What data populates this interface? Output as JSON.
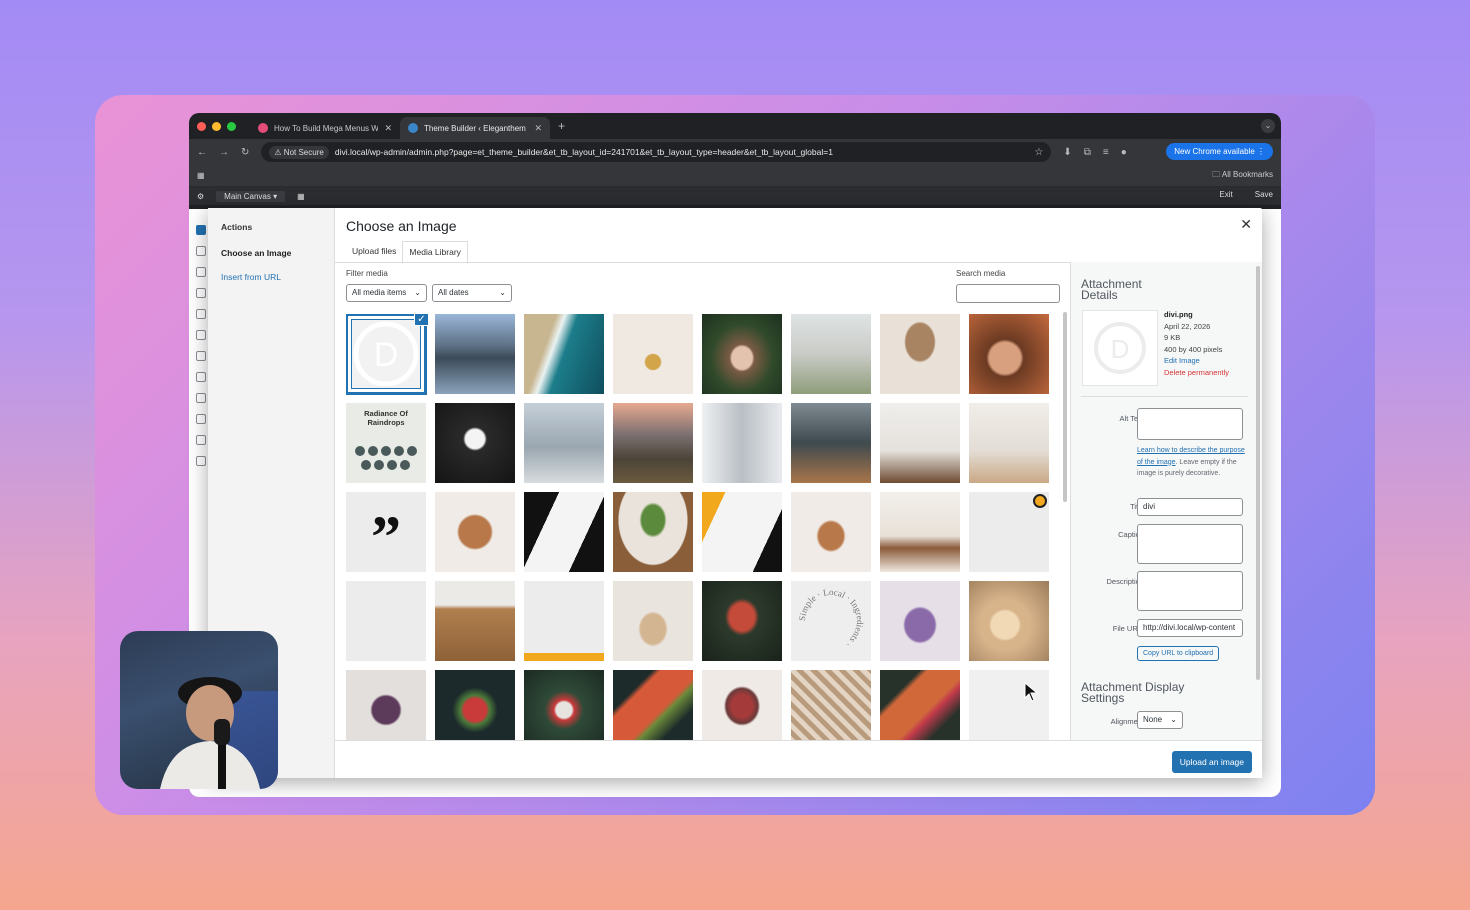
{
  "browser": {
    "tabs": [
      {
        "title": "How To Build Mega Menus W"
      },
      {
        "title": "Theme Builder ‹ Eleganthem"
      }
    ],
    "not_secure": "Not Secure",
    "url": "divi.local/wp-admin/admin.php?page=et_theme_builder&et_tb_layout_id=241701&et_tb_layout_type=header&et_tb_layout_global=1",
    "new_chrome": "New Chrome available",
    "bookmarks": "All Bookmarks"
  },
  "builder": {
    "canvas": "Main Canvas",
    "exit": "Exit",
    "save": "Save"
  },
  "modal": {
    "title": "Choose an Image",
    "sidebar": {
      "heading": "Actions",
      "current": "Choose an Image",
      "insert_url": "Insert from URL"
    },
    "tabs": [
      "Upload files",
      "Media Library"
    ],
    "filter_label": "Filter media",
    "filter_type": "All media items",
    "filter_date": "All dates",
    "search_label": "Search media",
    "thumb_text": {
      "book_title": "Radiance Of Raindrops",
      "quote": "”",
      "circle_text": "Simple · Local · Ingredients ·"
    },
    "upload_button": "Upload an image"
  },
  "details": {
    "heading": "Attachment Details",
    "filename": "divi.png",
    "date": "April 22, 2026",
    "size": "9 KB",
    "dimensions": "400 by 400 pixels",
    "edit": "Edit Image",
    "delete": "Delete permanently",
    "alt_label": "Alt Text",
    "help_link": "Learn how to describe the purpose of the image",
    "help_text": ". Leave empty if the image is purely decorative.",
    "title_label": "Title",
    "title_value": "divi",
    "caption_label": "Caption",
    "description_label": "Description",
    "fileurl_label": "File URL:",
    "fileurl_value": "http://divi.local/wp-content",
    "copy_btn": "Copy URL to clipboard",
    "display_heading": "Attachment Display Settings",
    "alignment_label": "Alignment",
    "alignment_value": "None"
  },
  "colors": {
    "accent": "#2271b1",
    "danger": "#d63638"
  }
}
